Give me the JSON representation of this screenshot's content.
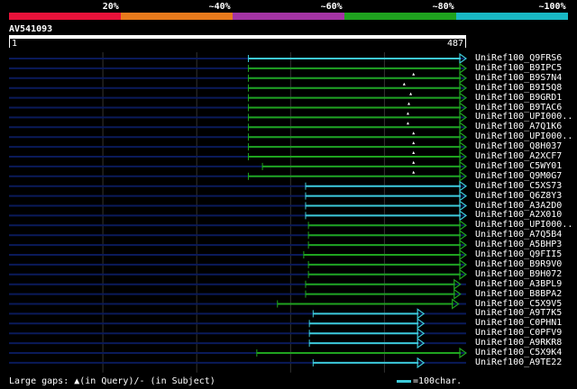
{
  "legend": {
    "colors": [
      "#e8123a",
      "#e87a1c",
      "#a434a4",
      "#1fa31f",
      "#19b8c4"
    ],
    "labels": [
      "20%",
      "~40%",
      "~60%",
      "~80%",
      "~100%"
    ]
  },
  "query": {
    "id": "AV541093",
    "start_label": "1",
    "end_label": "487",
    "length": 487
  },
  "footer": {
    "gaps_text": "Large gaps: ▲(in Query)/- (in Subject)",
    "scale_text": "=100char."
  },
  "colors": {
    "green": "#1fa31f",
    "cyan": "#3cc9d8",
    "track": "#0a1a5a",
    "grid": "#333333"
  },
  "hits": [
    {
      "label": "UniRef100_Q9FRS6",
      "start": 255,
      "end": 487,
      "color": "cyan",
      "gap": null
    },
    {
      "label": "UniRef100_B9IPC5",
      "start": 255,
      "end": 487,
      "color": "green",
      "gap": null
    },
    {
      "label": "UniRef100_B9S7N4",
      "start": 255,
      "end": 487,
      "color": "green",
      "gap": 431
    },
    {
      "label": "UniRef100_B9I5Q8",
      "start": 255,
      "end": 487,
      "color": "green",
      "gap": 421
    },
    {
      "label": "UniRef100_B9GRD1",
      "start": 255,
      "end": 487,
      "color": "green",
      "gap": 428
    },
    {
      "label": "UniRef100_B9TAC6",
      "start": 255,
      "end": 487,
      "color": "green",
      "gap": 426
    },
    {
      "label": "UniRef100_UPI000..",
      "start": 255,
      "end": 487,
      "color": "green",
      "gap": 425
    },
    {
      "label": "UniRef100_A7Q1K6",
      "start": 255,
      "end": 487,
      "color": "green",
      "gap": 425
    },
    {
      "label": "UniRef100_UPI000..",
      "start": 255,
      "end": 487,
      "color": "green",
      "gap": 431
    },
    {
      "label": "UniRef100_Q8H037",
      "start": 255,
      "end": 487,
      "color": "green",
      "gap": 431
    },
    {
      "label": "UniRef100_A2XCF7",
      "start": 255,
      "end": 487,
      "color": "green",
      "gap": 431
    },
    {
      "label": "UniRef100_C5WY01",
      "start": 270,
      "end": 487,
      "color": "green",
      "gap": 431
    },
    {
      "label": "UniRef100_Q9M0G7",
      "start": 255,
      "end": 487,
      "color": "green",
      "gap": 431
    },
    {
      "label": "UniRef100_C5XS73",
      "start": 316,
      "end": 487,
      "color": "cyan",
      "gap": null
    },
    {
      "label": "UniRef100_Q6Z8Y3",
      "start": 316,
      "end": 487,
      "color": "cyan",
      "gap": null
    },
    {
      "label": "UniRef100_A3A2D0",
      "start": 316,
      "end": 487,
      "color": "cyan",
      "gap": null
    },
    {
      "label": "UniRef100_A2X010",
      "start": 316,
      "end": 487,
      "color": "cyan",
      "gap": null
    },
    {
      "label": "UniRef100_UPI000..",
      "start": 319,
      "end": 487,
      "color": "green",
      "gap": null
    },
    {
      "label": "UniRef100_A7Q5B4",
      "start": 319,
      "end": 487,
      "color": "green",
      "gap": null
    },
    {
      "label": "UniRef100_A5BHP3",
      "start": 319,
      "end": 487,
      "color": "green",
      "gap": null
    },
    {
      "label": "UniRef100_Q9FII5",
      "start": 314,
      "end": 487,
      "color": "green",
      "gap": null
    },
    {
      "label": "UniRef100_B9R9V0",
      "start": 319,
      "end": 487,
      "color": "green",
      "gap": null
    },
    {
      "label": "UniRef100_B9H072",
      "start": 319,
      "end": 487,
      "color": "green",
      "gap": null
    },
    {
      "label": "UniRef100_A3BPL9",
      "start": 316,
      "end": 481,
      "color": "green",
      "gap": null
    },
    {
      "label": "UniRef100_B8BPA2",
      "start": 316,
      "end": 481,
      "color": "green",
      "gap": null
    },
    {
      "label": "UniRef100_C5X9V5",
      "start": 286,
      "end": 479,
      "color": "green",
      "gap": null
    },
    {
      "label": "UniRef100_A9T7K5",
      "start": 324,
      "end": 442,
      "color": "cyan",
      "gap": null
    },
    {
      "label": "UniRef100_C0PHN1",
      "start": 320,
      "end": 442,
      "color": "cyan",
      "gap": null
    },
    {
      "label": "UniRef100_C0PFV9",
      "start": 320,
      "end": 442,
      "color": "cyan",
      "gap": null
    },
    {
      "label": "UniRef100_A9RKR8",
      "start": 320,
      "end": 442,
      "color": "cyan",
      "gap": null
    },
    {
      "label": "UniRef100_C5X9K4",
      "start": 264,
      "end": 487,
      "color": "green",
      "gap": null
    },
    {
      "label": "UniRef100_A9TE22",
      "start": 324,
      "end": 442,
      "color": "cyan",
      "gap": null
    }
  ]
}
